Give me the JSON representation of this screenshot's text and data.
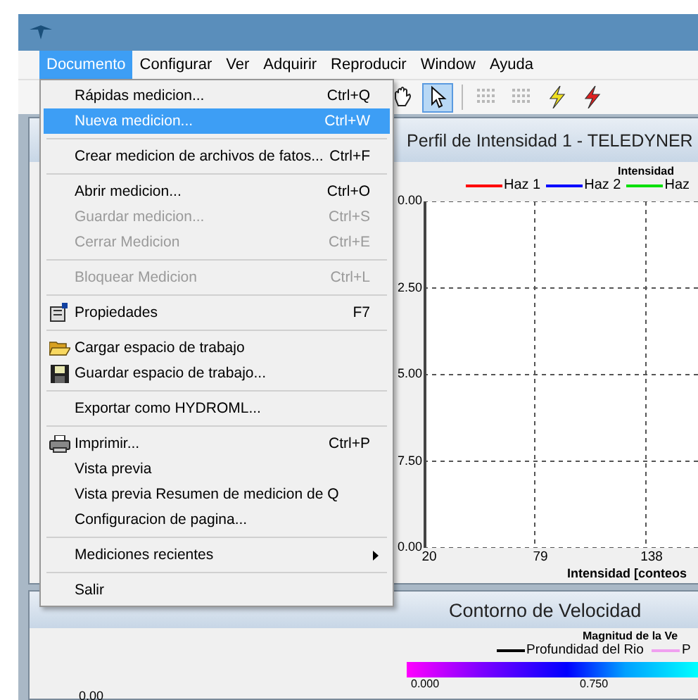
{
  "menubar": {
    "items": [
      {
        "label": "Documento",
        "selected": true
      },
      {
        "label": "Configurar",
        "selected": false
      },
      {
        "label": "Ver",
        "selected": false
      },
      {
        "label": "Adquirir",
        "selected": false
      },
      {
        "label": "Reproducir",
        "selected": false
      },
      {
        "label": "Window",
        "selected": false
      },
      {
        "label": "Ayuda",
        "selected": false
      }
    ]
  },
  "toolbar": {
    "buttons": [
      {
        "kind": "hand",
        "selected": false
      },
      {
        "kind": "pointer",
        "selected": true
      },
      {
        "kind": "grid",
        "selected": false
      },
      {
        "kind": "grid",
        "selected": false
      },
      {
        "kind": "bolt-yellow",
        "selected": false
      },
      {
        "kind": "bolt-red",
        "selected": false
      }
    ]
  },
  "menu": {
    "items": [
      {
        "kind": "item",
        "label": "Rápidas medicion...",
        "shortcut": "Ctrl+Q",
        "disabled": false,
        "selected": false
      },
      {
        "kind": "item",
        "label": "Nueva medicion...",
        "shortcut": "Ctrl+W",
        "disabled": false,
        "selected": true
      },
      {
        "kind": "separator"
      },
      {
        "kind": "item",
        "label": "Crear medicion de archivos de fatos...",
        "shortcut": "Ctrl+F",
        "disabled": false,
        "selected": false
      },
      {
        "kind": "separator"
      },
      {
        "kind": "item",
        "label": "Abrir medicion...",
        "shortcut": "Ctrl+O",
        "disabled": false,
        "selected": false
      },
      {
        "kind": "item",
        "label": "Guardar medicion...",
        "shortcut": "Ctrl+S",
        "disabled": true,
        "selected": false
      },
      {
        "kind": "item",
        "label": "Cerrar Medicion",
        "shortcut": "Ctrl+E",
        "disabled": true,
        "selected": false
      },
      {
        "kind": "separator"
      },
      {
        "kind": "item",
        "label": "Bloquear Medicion",
        "shortcut": "Ctrl+L",
        "disabled": true,
        "selected": false
      },
      {
        "kind": "separator"
      },
      {
        "kind": "properties",
        "label": "Propiedades",
        "shortcut": "F7",
        "disabled": false,
        "selected": false
      },
      {
        "kind": "separator"
      },
      {
        "kind": "folder",
        "label": "Cargar espacio de trabajo",
        "disabled": false,
        "selected": false
      },
      {
        "kind": "disk",
        "label": "Guardar espacio de trabajo...",
        "disabled": false,
        "selected": false
      },
      {
        "kind": "separator"
      },
      {
        "kind": "item",
        "label": "Exportar como HYDROML...",
        "disabled": false,
        "selected": false
      },
      {
        "kind": "separator"
      },
      {
        "kind": "printer",
        "label": "Imprimir...",
        "shortcut": "Ctrl+P",
        "disabled": false,
        "selected": false
      },
      {
        "kind": "item",
        "label": "Vista previa",
        "disabled": false,
        "selected": false
      },
      {
        "kind": "item",
        "label": "Vista previa Resumen de medicion de Q",
        "disabled": false,
        "selected": false
      },
      {
        "kind": "item",
        "label": "Configuracion de pagina...",
        "disabled": false,
        "selected": false
      },
      {
        "kind": "separator"
      },
      {
        "kind": "submenu",
        "label": "Mediciones recientes",
        "disabled": false,
        "selected": false
      },
      {
        "kind": "separator"
      },
      {
        "kind": "item",
        "label": "Salir",
        "disabled": false,
        "selected": false
      }
    ]
  },
  "intensity_panel": {
    "title": "Perfil de Intensidad 1 - TELEDYNER",
    "plot_title": "Intensidad",
    "legend": [
      {
        "name": "Haz 1",
        "color": "#ff0000"
      },
      {
        "name": "Haz 2",
        "color": "#0000ff"
      },
      {
        "name": "Haz",
        "color": "#00e000"
      }
    ],
    "y_labels": [
      "0.00",
      "2.50",
      "5.00",
      "7.50",
      "0.00"
    ],
    "x_labels": [
      "20",
      "79",
      "138"
    ],
    "x_axis_label": "Intensidad [conteos"
  },
  "velocity_panel": {
    "title": "Contorno de Velocidad",
    "legend_title": "Magnitud de la Ve",
    "legend": [
      {
        "name": "Profundidad del Rio",
        "color": "#000000"
      },
      {
        "name": "P",
        "color": "#f0a0f0"
      }
    ],
    "scale_ticks": [
      "0.000",
      "0.750"
    ],
    "axis_label": "0.00"
  }
}
